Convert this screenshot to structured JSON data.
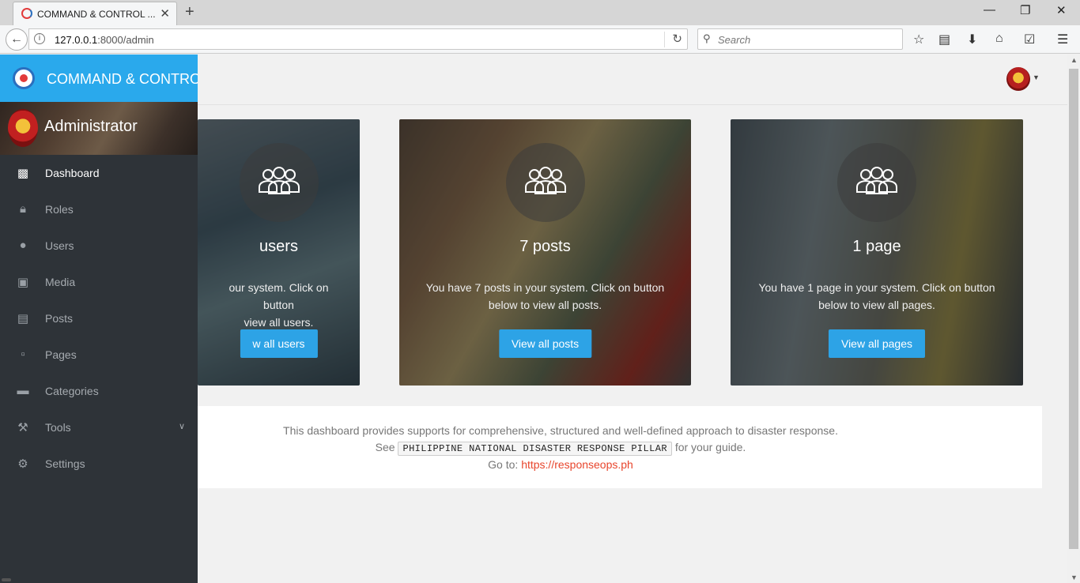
{
  "browser": {
    "tab_title": "COMMAND & CONTROL ...",
    "tab_close": "✕",
    "new_tab": "+",
    "url_host": "127.0.0.1",
    "url_rest": ":8000/admin",
    "search_placeholder": "Search",
    "window_controls": [
      "minimize",
      "restore",
      "close"
    ]
  },
  "sidebar": {
    "brand_title": "COMMAND & CONTROL",
    "user_name": "Administrator",
    "items": [
      {
        "label": "Dashboard",
        "icon": "dashboard-icon",
        "active": true
      },
      {
        "label": "Roles",
        "icon": "lock-icon"
      },
      {
        "label": "Users",
        "icon": "user-icon"
      },
      {
        "label": "Media",
        "icon": "image-icon"
      },
      {
        "label": "Posts",
        "icon": "news-icon"
      },
      {
        "label": "Pages",
        "icon": "file-icon"
      },
      {
        "label": "Categories",
        "icon": "folder-icon"
      },
      {
        "label": "Tools",
        "icon": "tools-icon",
        "has_submenu": true
      },
      {
        "label": "Settings",
        "icon": "gear-icon"
      }
    ]
  },
  "cards": [
    {
      "count": "users",
      "desc_line1": "our system. Click on button",
      "desc_line2": "view all users.",
      "button": "w all users"
    },
    {
      "count": "7 posts",
      "desc_line1": "You have 7 posts in your system. Click on button",
      "desc_line2": "below to view all posts.",
      "button": "View all posts"
    },
    {
      "count": "1 page",
      "desc_line1": "You have 1 page in your system. Click on button",
      "desc_line2": "below to view all pages.",
      "button": "View all pages"
    }
  ],
  "info": {
    "line1": "This dashboard provides supports for comprehensive, structured and well-defined approach to disaster response.",
    "see": "See",
    "code": "PHILIPPINE NATIONAL DISASTER RESPONSE PILLAR",
    "guide": "for your guide.",
    "goto": "Go to:",
    "link": "https://responseops.ph"
  },
  "colors": {
    "brand": "#2aa9ec",
    "button": "#2da3e6",
    "sidebar_bg": "#2e3338",
    "link": "#e8452c"
  }
}
